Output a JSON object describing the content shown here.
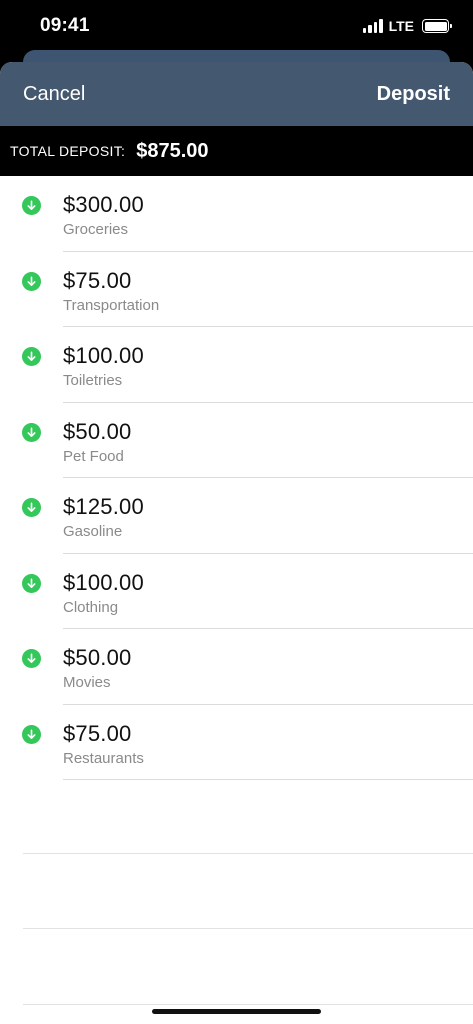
{
  "status": {
    "time": "09:41",
    "carrier": "LTE"
  },
  "nav": {
    "cancel_label": "Cancel",
    "deposit_label": "Deposit"
  },
  "total": {
    "label": "TOTAL DEPOSIT:",
    "value": "$875.00"
  },
  "items": [
    {
      "amount": "$300.00",
      "category": "Groceries"
    },
    {
      "amount": "$75.00",
      "category": "Transportation"
    },
    {
      "amount": "$100.00",
      "category": "Toiletries"
    },
    {
      "amount": "$50.00",
      "category": "Pet Food"
    },
    {
      "amount": "$125.00",
      "category": "Gasoline"
    },
    {
      "amount": "$100.00",
      "category": "Clothing"
    },
    {
      "amount": "$50.00",
      "category": "Movies"
    },
    {
      "amount": "$75.00",
      "category": "Restaurants"
    }
  ],
  "colors": {
    "nav_background": "#44596f",
    "deposit_icon": "#34c759",
    "total_bar_background": "#000000"
  },
  "icons": {
    "item_icon": "arrow-down-circle-icon"
  }
}
